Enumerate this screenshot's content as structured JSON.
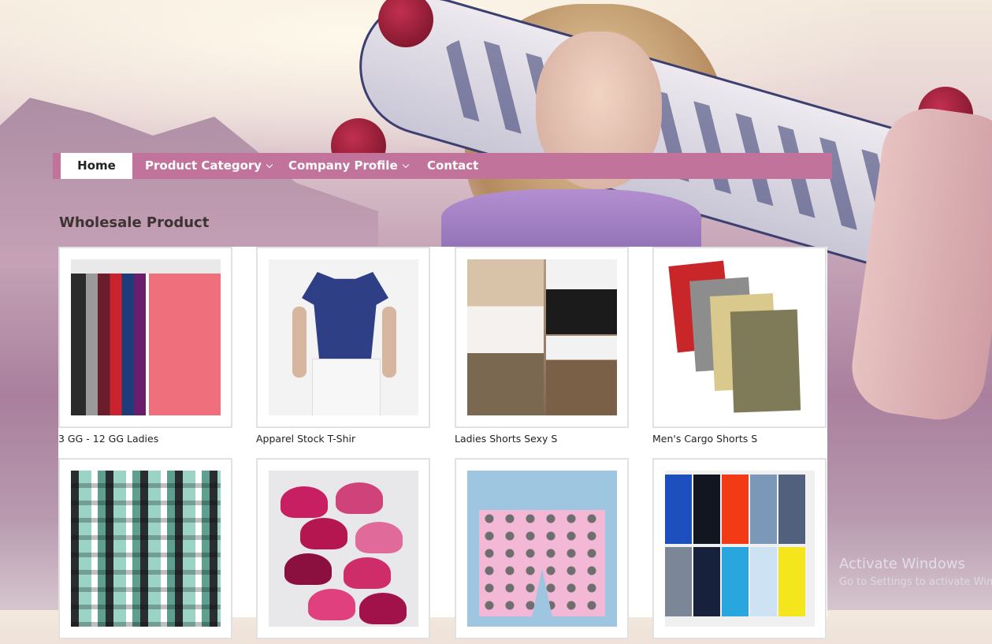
{
  "nav": {
    "items": [
      {
        "label": "Home",
        "active": true
      },
      {
        "label": "Product Category",
        "has_dropdown": true
      },
      {
        "label": "Company Profile",
        "has_dropdown": true
      },
      {
        "label": "Contact"
      }
    ],
    "bar_color": "#c1739c"
  },
  "section": {
    "title": "Wholesale Product"
  },
  "products": [
    {
      "caption": "3 GG - 12 GG Ladies"
    },
    {
      "caption": "Apparel Stock T-Shir"
    },
    {
      "caption": "Ladies Shorts Sexy S"
    },
    {
      "caption": "Men's Cargo Shorts S"
    },
    {
      "caption": ""
    },
    {
      "caption": ""
    },
    {
      "caption": ""
    },
    {
      "caption": ""
    }
  ],
  "watermark": {
    "line1": "Activate Windows",
    "line2": "Go to Settings to activate Win"
  }
}
